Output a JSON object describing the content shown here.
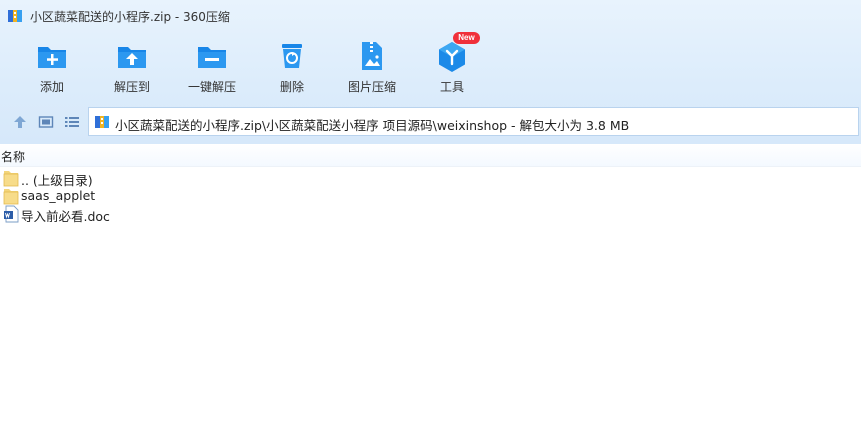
{
  "window": {
    "title": "小区蔬菜配送的小程序.zip - 360压缩"
  },
  "toolbar": {
    "items": [
      {
        "label": "添加"
      },
      {
        "label": "解压到"
      },
      {
        "label": "一键解压"
      },
      {
        "label": "删除"
      },
      {
        "label": "图片压缩"
      },
      {
        "label": "工具",
        "badge": "New"
      }
    ]
  },
  "address": {
    "path": "小区蔬菜配送的小程序.zip\\小区蔬菜配送小程序 项目源码\\weixinshop - 解包大小为 3.8 MB"
  },
  "list": {
    "header": {
      "name": "名称"
    },
    "rows": [
      {
        "name": ".. (上级目录)",
        "icon": "folder-up-icon"
      },
      {
        "name": "saas_applet",
        "icon": "folder-icon"
      },
      {
        "name": "导入前必看.doc",
        "icon": "word-doc-icon"
      }
    ]
  },
  "colors": {
    "accent": "#1a8ae6",
    "chrome_bg": "#dcecfb",
    "badge": "#f0303a"
  }
}
